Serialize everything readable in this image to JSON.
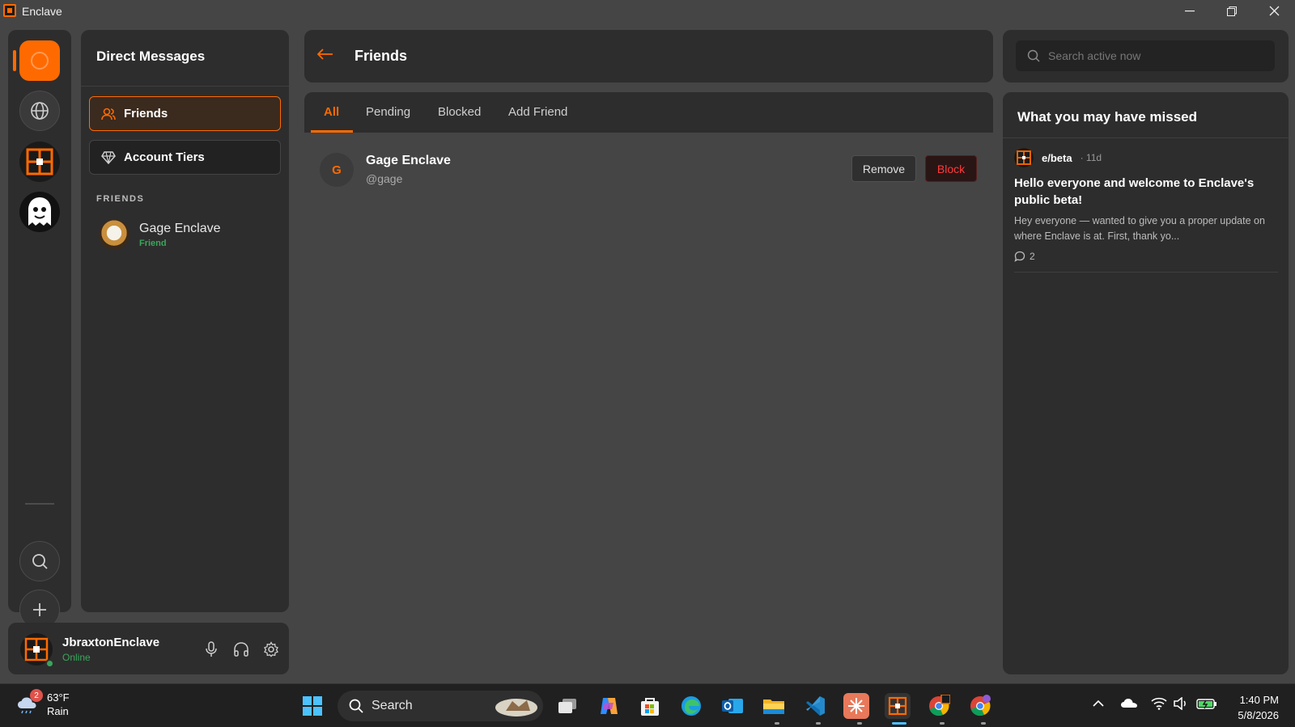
{
  "window": {
    "title": "Enclave",
    "minimize_icon": "minimize-icon",
    "restore_icon": "restore-icon",
    "close_icon": "close-icon"
  },
  "rail": {
    "items": [
      "home",
      "explore",
      "enclave-server",
      "ghost-server"
    ],
    "search_icon": "search-icon",
    "add_icon": "plus-icon"
  },
  "dm": {
    "header": "Direct Messages",
    "friends_label": "Friends",
    "tiers_label": "Account Tiers",
    "section_label": "FRIENDS",
    "friend": {
      "name": "Gage Enclave",
      "status": "Friend"
    }
  },
  "user": {
    "name": "JbraxtonEnclave",
    "status": "Online"
  },
  "main": {
    "title": "Friends",
    "tabs": [
      {
        "label": "All",
        "active": true
      },
      {
        "label": "Pending",
        "active": false
      },
      {
        "label": "Blocked",
        "active": false
      },
      {
        "label": "Add Friend",
        "active": false
      }
    ],
    "friend_row": {
      "initial": "G",
      "name": "Gage Enclave",
      "handle": "@gage",
      "remove_label": "Remove",
      "block_label": "Block"
    }
  },
  "right": {
    "search_placeholder": "Search active now",
    "missed_title": "What you may have missed",
    "post": {
      "community": "e/beta",
      "age": "· 11d",
      "title": "Hello everyone and welcome to Enclave's public beta!",
      "body": "Hey everyone — wanted to give you a proper update on where Enclave is at. First, thank yo...",
      "comments": "2"
    }
  },
  "taskbar": {
    "weather_badge": "2",
    "weather_temp": "63°F",
    "weather_desc": "Rain",
    "search_label": "Search",
    "time": "1:40 PM",
    "date": "5/8/2026"
  },
  "colors": {
    "accent": "#ff6a00",
    "online": "#3ba55c",
    "danger": "#ff3b3b"
  }
}
